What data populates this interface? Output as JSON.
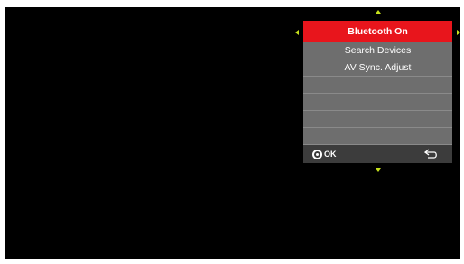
{
  "menu": {
    "items": [
      {
        "label": "Bluetooth On",
        "selected": true
      },
      {
        "label": "Search Devices",
        "selected": false
      },
      {
        "label": "AV Sync. Adjust",
        "selected": false
      },
      {
        "label": "",
        "selected": false
      },
      {
        "label": "",
        "selected": false
      },
      {
        "label": "",
        "selected": false
      },
      {
        "label": "",
        "selected": false
      }
    ],
    "footer": {
      "ok_label": "OK",
      "ok_icon": "ok-icon",
      "back_icon": "back-arrow-icon"
    }
  },
  "colors": {
    "accent": "#e8151c",
    "nav_arrow": "#c6e21c",
    "menu_bg": "#6e6e6e",
    "footer_bg": "#3c3c3c"
  }
}
